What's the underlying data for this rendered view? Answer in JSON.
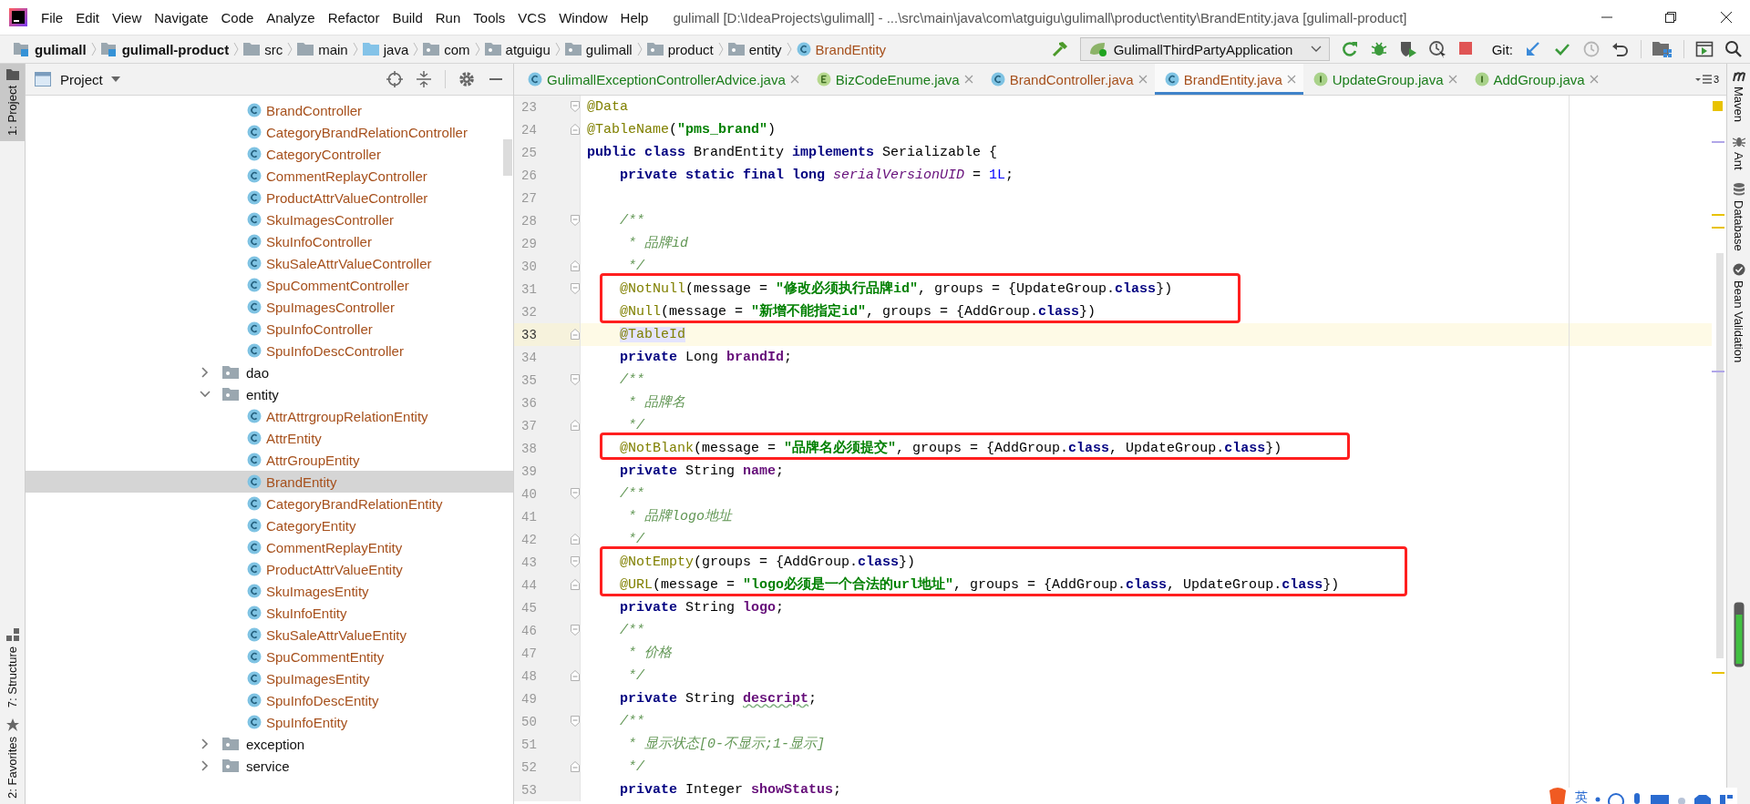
{
  "window": {
    "title": "gulimall [D:\\IdeaProjects\\gulimall] - ...\\src\\main\\java\\com\\atguigu\\gulimall\\product\\entity\\BrandEntity.java [gulimall-product]"
  },
  "menu": [
    "File",
    "Edit",
    "View",
    "Navigate",
    "Code",
    "Analyze",
    "Refactor",
    "Build",
    "Run",
    "Tools",
    "VCS",
    "Window",
    "Help"
  ],
  "breadcrumbs": [
    {
      "label": "gulimall",
      "kind": "module"
    },
    {
      "label": "gulimall-product",
      "kind": "module"
    },
    {
      "label": "src",
      "kind": "folder"
    },
    {
      "label": "main",
      "kind": "folder"
    },
    {
      "label": "java",
      "kind": "source_folder"
    },
    {
      "label": "com",
      "kind": "package"
    },
    {
      "label": "atguigu",
      "kind": "package"
    },
    {
      "label": "gulimall",
      "kind": "package"
    },
    {
      "label": "product",
      "kind": "package"
    },
    {
      "label": "entity",
      "kind": "package"
    },
    {
      "label": "BrandEntity",
      "kind": "class"
    }
  ],
  "run_config": {
    "label": "GulimallThirdPartyApplication"
  },
  "git_label": "Git:",
  "tool_windows": {
    "left": [
      {
        "label": "1: Project",
        "kind": "project",
        "selected": true
      },
      {
        "label": "7: Structure",
        "kind": "structure",
        "selected": false
      },
      {
        "label": "2: Favorites",
        "kind": "favorites",
        "selected": false
      }
    ],
    "right": [
      {
        "label": "Maven",
        "kind": "maven",
        "selected": false
      },
      {
        "label": "Ant",
        "kind": "ant",
        "selected": false
      },
      {
        "label": "Database",
        "kind": "database",
        "selected": false
      },
      {
        "label": "Bean Validation",
        "kind": "bean_validation",
        "selected": false
      }
    ]
  },
  "project_panel": {
    "title": "Project",
    "tree": [
      {
        "kind": "offscreen_parent",
        "children": [
          {
            "label": "BrandController",
            "kind": "class",
            "selected": false
          },
          {
            "label": "CategoryBrandRelationController",
            "kind": "class",
            "selected": false
          },
          {
            "label": "CategoryController",
            "kind": "class",
            "selected": false
          },
          {
            "label": "CommentReplayController",
            "kind": "class",
            "selected": false
          },
          {
            "label": "ProductAttrValueController",
            "kind": "class",
            "selected": false
          },
          {
            "label": "SkuImagesController",
            "kind": "class",
            "selected": false
          },
          {
            "label": "SkuInfoController",
            "kind": "class",
            "selected": false
          },
          {
            "label": "SkuSaleAttrValueController",
            "kind": "class",
            "selected": false
          },
          {
            "label": "SpuCommentController",
            "kind": "class",
            "selected": false
          },
          {
            "label": "SpuImagesController",
            "kind": "class",
            "selected": false
          },
          {
            "label": "SpuInfoController",
            "kind": "class",
            "selected": false
          },
          {
            "label": "SpuInfoDescController",
            "kind": "class",
            "selected": false
          }
        ]
      },
      {
        "label": "dao",
        "kind": "folder",
        "expanded": false,
        "selected": false
      },
      {
        "label": "entity",
        "kind": "folder",
        "expanded": true,
        "selected": false,
        "children": [
          {
            "label": "AttrAttrgroupRelationEntity",
            "kind": "class",
            "selected": false
          },
          {
            "label": "AttrEntity",
            "kind": "class",
            "selected": false
          },
          {
            "label": "AttrGroupEntity",
            "kind": "class",
            "selected": false
          },
          {
            "label": "BrandEntity",
            "kind": "class",
            "selected": true
          },
          {
            "label": "CategoryBrandRelationEntity",
            "kind": "class",
            "selected": false
          },
          {
            "label": "CategoryEntity",
            "kind": "class",
            "selected": false
          },
          {
            "label": "CommentReplayEntity",
            "kind": "class",
            "selected": false
          },
          {
            "label": "ProductAttrValueEntity",
            "kind": "class",
            "selected": false
          },
          {
            "label": "SkuImagesEntity",
            "kind": "class",
            "selected": false
          },
          {
            "label": "SkuInfoEntity",
            "kind": "class",
            "selected": false
          },
          {
            "label": "SkuSaleAttrValueEntity",
            "kind": "class",
            "selected": false
          },
          {
            "label": "SpuCommentEntity",
            "kind": "class",
            "selected": false
          },
          {
            "label": "SpuImagesEntity",
            "kind": "class",
            "selected": false
          },
          {
            "label": "SpuInfoDescEntity",
            "kind": "class",
            "selected": false
          },
          {
            "label": "SpuInfoEntity",
            "kind": "class",
            "selected": false
          }
        ]
      },
      {
        "label": "exception",
        "kind": "folder",
        "expanded": false,
        "selected": false
      },
      {
        "label": "service",
        "kind": "folder",
        "expanded": false,
        "selected": false
      }
    ]
  },
  "editor_tabs": [
    {
      "label": "GulimallExceptionControllerAdvice.java",
      "kind": "class",
      "color": "#1b7d1b",
      "selected": false
    },
    {
      "label": "BizCodeEnume.java",
      "kind": "enum",
      "color": "#1b7d1b",
      "selected": false
    },
    {
      "label": "BrandController.java",
      "kind": "class",
      "color": "#a6501c",
      "selected": false
    },
    {
      "label": "BrandEntity.java",
      "kind": "class",
      "color": "#a6501c",
      "selected": true
    },
    {
      "label": "UpdateGroup.java",
      "kind": "interface",
      "color": "#1b7d1b",
      "selected": false
    },
    {
      "label": "AddGroup.java",
      "kind": "interface",
      "color": "#1b7d1b",
      "selected": false
    }
  ],
  "tab_overflow_count": "3",
  "editor": {
    "lines": [
      {
        "number": "23",
        "fold_start": true,
        "tokens": [
          {
            "text": "@Data",
            "kind": "annotation"
          }
        ]
      },
      {
        "number": "24",
        "fold_end": true,
        "tokens": [
          {
            "text": "@TableName",
            "kind": "annotation"
          },
          {
            "text": "(",
            "kind": "plain"
          },
          {
            "text": "\"pms_brand\"",
            "kind": "string"
          },
          {
            "text": ")",
            "kind": "plain"
          }
        ]
      },
      {
        "number": "25",
        "tokens": [
          {
            "text": "public class",
            "kind": "keyword"
          },
          {
            "text": " BrandEntity ",
            "kind": "plain"
          },
          {
            "text": "implements",
            "kind": "keyword"
          },
          {
            "text": " Serializable {",
            "kind": "plain"
          }
        ],
        "children": [
          {
            "number": "26",
            "tokens": [
              {
                "text": "private static final long",
                "kind": "keyword"
              },
              {
                "text": " serialVersionUID",
                "kind": "static_field"
              },
              {
                "text": " = ",
                "kind": "plain"
              },
              {
                "text": "1L",
                "kind": "number"
              },
              {
                "text": ";",
                "kind": "plain"
              }
            ]
          },
          {
            "number": "27"
          },
          {
            "number": "28",
            "fold_start": true,
            "tokens": [
              {
                "text": "/**",
                "kind": "doc"
              }
            ]
          },
          {
            "number": "29",
            "tokens": [
              {
                "text": " * 品牌id",
                "kind": "doc"
              }
            ]
          },
          {
            "number": "30",
            "fold_end": true,
            "tokens": [
              {
                "text": " */",
                "kind": "doc"
              }
            ]
          },
          {
            "kind": "boxed",
            "lines": [
              {
                "number": "31",
                "fold_start": true,
                "tokens": [
                  {
                    "text": "@NotNull",
                    "kind": "annotation"
                  },
                  {
                    "text": "(message = ",
                    "kind": "plain"
                  },
                  {
                    "text": "\"修改必须执行品牌id\"",
                    "kind": "string"
                  },
                  {
                    "text": ", groups = {UpdateGroup.",
                    "kind": "plain"
                  },
                  {
                    "text": "class",
                    "kind": "keyword"
                  },
                  {
                    "text": "})",
                    "kind": "plain"
                  }
                ]
              },
              {
                "number": "32",
                "tokens": [
                  {
                    "text": "@Null",
                    "kind": "annotation"
                  },
                  {
                    "text": "(message = ",
                    "kind": "plain"
                  },
                  {
                    "text": "\"新增不能指定id\"",
                    "kind": "string"
                  },
                  {
                    "text": ", groups = {AddGroup.",
                    "kind": "plain"
                  },
                  {
                    "text": "class",
                    "kind": "keyword"
                  },
                  {
                    "text": "})",
                    "kind": "plain"
                  }
                ]
              }
            ]
          },
          {
            "number": "33",
            "fold_end": true,
            "current": true,
            "tokens": [
              {
                "text": "@TableId",
                "kind": "marked_annotation"
              }
            ]
          },
          {
            "number": "34",
            "tokens": [
              {
                "text": "private",
                "kind": "keyword"
              },
              {
                "text": " Long ",
                "kind": "plain"
              },
              {
                "text": "brandId",
                "kind": "field"
              },
              {
                "text": ";",
                "kind": "plain"
              }
            ]
          },
          {
            "number": "35",
            "fold_start": true,
            "tokens": [
              {
                "text": "/**",
                "kind": "doc"
              }
            ]
          },
          {
            "number": "36",
            "tokens": [
              {
                "text": " * 品牌名",
                "kind": "doc"
              }
            ]
          },
          {
            "number": "37",
            "fold_end": true,
            "tokens": [
              {
                "text": " */",
                "kind": "doc"
              }
            ]
          },
          {
            "kind": "boxed",
            "lines": [
              {
                "number": "38",
                "tokens": [
                  {
                    "text": "@NotBlank",
                    "kind": "annotation"
                  },
                  {
                    "text": "(message = ",
                    "kind": "plain"
                  },
                  {
                    "text": "\"品牌名必须提交\"",
                    "kind": "string"
                  },
                  {
                    "text": ", groups = {AddGroup.",
                    "kind": "plain"
                  },
                  {
                    "text": "class",
                    "kind": "keyword"
                  },
                  {
                    "text": ", UpdateGroup.",
                    "kind": "plain"
                  },
                  {
                    "text": "class",
                    "kind": "keyword"
                  },
                  {
                    "text": "})",
                    "kind": "plain"
                  }
                ]
              }
            ]
          },
          {
            "number": "39",
            "tokens": [
              {
                "text": "private",
                "kind": "keyword"
              },
              {
                "text": " String ",
                "kind": "plain"
              },
              {
                "text": "name",
                "kind": "field"
              },
              {
                "text": ";",
                "kind": "plain"
              }
            ]
          },
          {
            "number": "40",
            "fold_start": true,
            "tokens": [
              {
                "text": "/**",
                "kind": "doc"
              }
            ]
          },
          {
            "number": "41",
            "tokens": [
              {
                "text": " * 品牌logo地址",
                "kind": "doc"
              }
            ]
          },
          {
            "number": "42",
            "fold_end": true,
            "tokens": [
              {
                "text": " */",
                "kind": "doc"
              }
            ]
          },
          {
            "kind": "boxed",
            "lines": [
              {
                "number": "43",
                "fold_start": true,
                "tokens": [
                  {
                    "text": "@NotEmpty",
                    "kind": "annotation"
                  },
                  {
                    "text": "(groups = {AddGroup.",
                    "kind": "plain"
                  },
                  {
                    "text": "class",
                    "kind": "keyword"
                  },
                  {
                    "text": "})",
                    "kind": "plain"
                  }
                ]
              },
              {
                "number": "44",
                "fold_end": true,
                "tokens": [
                  {
                    "text": "@URL",
                    "kind": "annotation"
                  },
                  {
                    "text": "(message = ",
                    "kind": "plain"
                  },
                  {
                    "text": "\"logo必须是一个合法的url地址\"",
                    "kind": "string"
                  },
                  {
                    "text": ", groups = {AddGroup.",
                    "kind": "plain"
                  },
                  {
                    "text": "class",
                    "kind": "keyword"
                  },
                  {
                    "text": ", UpdateGroup.",
                    "kind": "plain"
                  },
                  {
                    "text": "class",
                    "kind": "keyword"
                  },
                  {
                    "text": "})",
                    "kind": "plain"
                  }
                ]
              }
            ]
          },
          {
            "number": "45",
            "tokens": [
              {
                "text": "private",
                "kind": "keyword"
              },
              {
                "text": " String ",
                "kind": "plain"
              },
              {
                "text": "logo",
                "kind": "field"
              },
              {
                "text": ";",
                "kind": "plain"
              }
            ]
          },
          {
            "number": "46",
            "fold_start": true,
            "tokens": [
              {
                "text": "/**",
                "kind": "doc"
              }
            ]
          },
          {
            "number": "47",
            "tokens": [
              {
                "text": " * 价格",
                "kind": "doc"
              }
            ]
          },
          {
            "number": "48",
            "fold_end": true,
            "tokens": [
              {
                "text": " */",
                "kind": "doc"
              }
            ]
          },
          {
            "number": "49",
            "tokens": [
              {
                "text": "private",
                "kind": "keyword"
              },
              {
                "text": " String ",
                "kind": "plain"
              },
              {
                "text": "descript",
                "kind": "typo_field"
              },
              {
                "text": ";",
                "kind": "plain"
              }
            ]
          },
          {
            "number": "50",
            "fold_start": true,
            "tokens": [
              {
                "text": "/**",
                "kind": "doc"
              }
            ]
          },
          {
            "number": "51",
            "tokens": [
              {
                "text": " * 显示状态[0-不显示;1-显示]",
                "kind": "doc"
              }
            ]
          },
          {
            "number": "52",
            "fold_end": true,
            "tokens": [
              {
                "text": " */",
                "kind": "doc"
              }
            ]
          },
          {
            "number": "53",
            "tokens": [
              {
                "text": "private",
                "kind": "keyword"
              },
              {
                "text": " Integer ",
                "kind": "plain"
              },
              {
                "text": "showStatus",
                "kind": "field"
              },
              {
                "text": ";",
                "kind": "plain"
              }
            ]
          }
        ]
      }
    ]
  },
  "ime_bar": {
    "label": "英"
  }
}
